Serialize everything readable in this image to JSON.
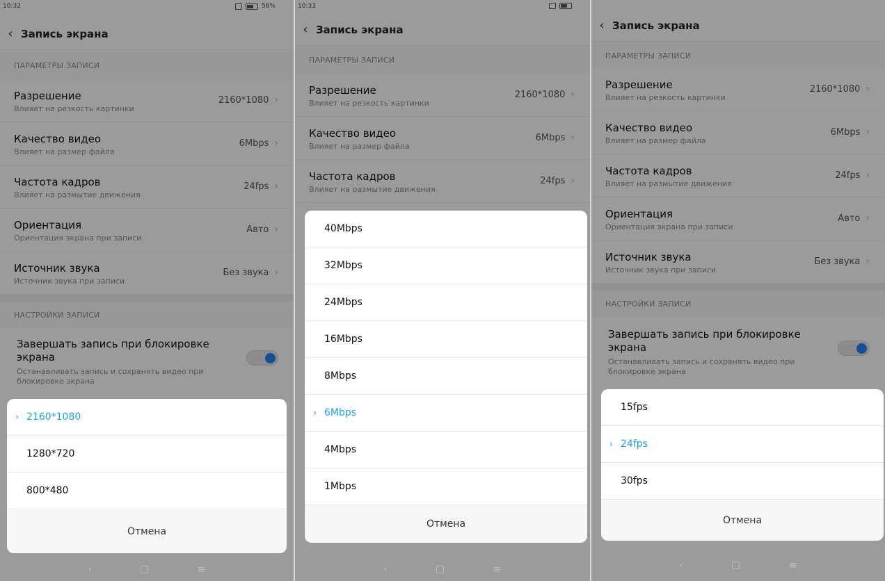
{
  "screens": [
    {
      "time": "10:32",
      "battery": "56%",
      "title": "Запись экрана",
      "section_params": "ПАРАМЕТРЫ ЗАПИСИ",
      "settings": [
        {
          "label": "Разрешение",
          "desc": "Влияет на резкость картинки",
          "value": "2160*1080"
        },
        {
          "label": "Качество видео",
          "desc": "Влияет на размер файла",
          "value": "6Mbps"
        },
        {
          "label": "Частота кадров",
          "desc": "Влияет на размытие движения",
          "value": "24fps"
        },
        {
          "label": "Ориентация",
          "desc": "Ориентация экрана при записи",
          "value": "Авто"
        },
        {
          "label": "Источник звука",
          "desc": "Источник звука при записи",
          "value": "Без звука"
        }
      ],
      "section_settings": "НАСТРОЙКИ ЗАПИСИ",
      "toggle": {
        "label": "Завершать запись при блокировке экрана",
        "desc": "Останавливать запись и сохранять видео при блокировке экрана",
        "on": true
      },
      "sheet": {
        "options": [
          "2160*1080",
          "1280*720",
          "800*480"
        ],
        "selected": 0,
        "cancel": "Отмена"
      }
    },
    {
      "time": "10:33",
      "title": "Запись экрана",
      "section_params": "ПАРАМЕТРЫ ЗАПИСИ",
      "settings": [
        {
          "label": "Разрешение",
          "desc": "Влияет на резкость картинки",
          "value": "2160*1080"
        },
        {
          "label": "Качество видео",
          "desc": "Влияет на размер файла",
          "value": "6Mbps"
        },
        {
          "label": "Частота кадров",
          "desc": "Влияет на размытие движения",
          "value": "24fps"
        }
      ],
      "sheet": {
        "options": [
          "40Mbps",
          "32Mbps",
          "24Mbps",
          "16Mbps",
          "8Mbps",
          "6Mbps",
          "4Mbps",
          "1Mbps"
        ],
        "selected": 5,
        "cancel": "Отмена"
      }
    },
    {
      "title": "Запись экрана",
      "section_params": "ПАРАМЕТРЫ ЗАПИСИ",
      "settings": [
        {
          "label": "Разрешение",
          "desc": "Влияет на резкость картинки",
          "value": "2160*1080"
        },
        {
          "label": "Качество видео",
          "desc": "Влияет на размер файла",
          "value": "6Mbps"
        },
        {
          "label": "Частота кадров",
          "desc": "Влияет на размытие движения",
          "value": "24fps"
        },
        {
          "label": "Ориентация",
          "desc": "Ориентация экрана при записи",
          "value": "Авто"
        },
        {
          "label": "Источник звука",
          "desc": "Источник звука при записи",
          "value": "Без звука"
        }
      ],
      "section_settings": "НАСТРОЙКИ ЗАПИСИ",
      "toggle": {
        "label": "Завершать запись при блокировке экрана",
        "desc": "Останавливать запись и сохранять видео при блокировке экрана",
        "on": true
      },
      "sheet": {
        "options": [
          "15fps",
          "24fps",
          "30fps"
        ],
        "selected": 1,
        "cancel": "Отмена"
      }
    }
  ],
  "colors": {
    "accent": "#1aa3e8",
    "toggle_on": "#1f7ff4"
  }
}
